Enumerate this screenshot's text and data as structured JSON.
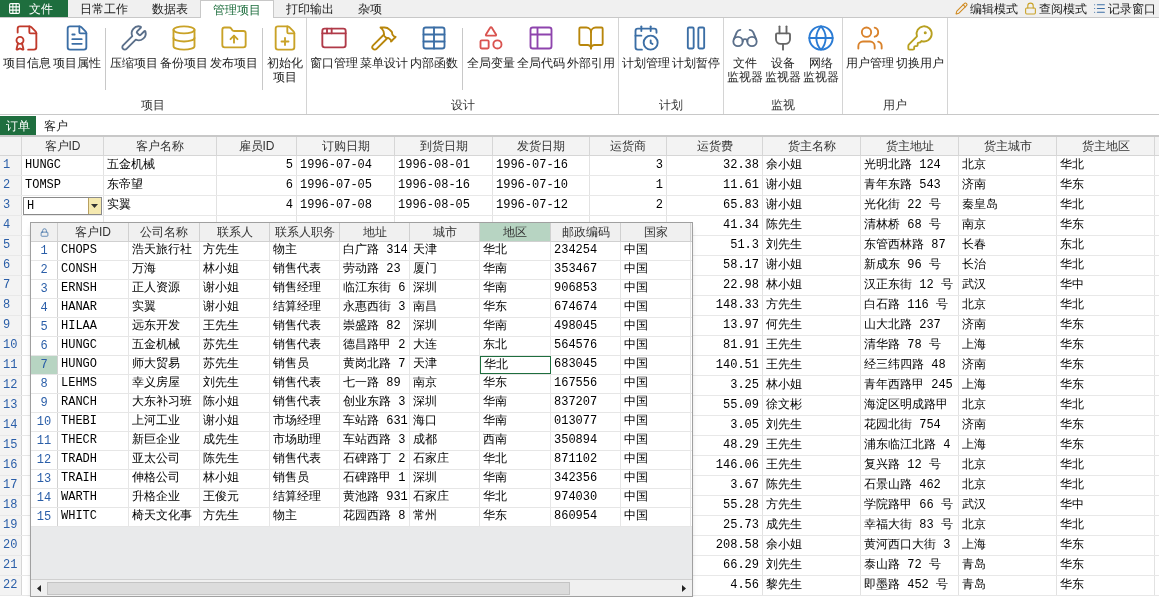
{
  "file_menu": {
    "label": "文件"
  },
  "menu_tabs": [
    {
      "label": "日常工作",
      "selected": false
    },
    {
      "label": "数据表",
      "selected": false
    },
    {
      "label": "管理项目",
      "selected": true
    },
    {
      "label": "打印输出",
      "selected": false
    },
    {
      "label": "杂项",
      "selected": false
    }
  ],
  "mode_buttons": [
    {
      "label": "编辑模式"
    },
    {
      "label": "查阅模式"
    },
    {
      "label": "记录窗口"
    }
  ],
  "ribbon_groups": [
    {
      "title": "项目",
      "buttons": [
        {
          "lines": [
            "项目信息"
          ],
          "separator_before": false
        },
        {
          "lines": [
            "项目属性"
          ],
          "separator_before": false
        },
        {
          "lines": [
            "压缩项目"
          ],
          "separator_before": true
        },
        {
          "lines": [
            "备份项目"
          ],
          "separator_before": false
        },
        {
          "lines": [
            "发布项目"
          ],
          "separator_before": false
        },
        {
          "lines": [
            "初始化",
            "项目"
          ],
          "separator_before": true
        }
      ]
    },
    {
      "title": "设计",
      "buttons": [
        {
          "lines": [
            "窗口管理"
          ],
          "separator_before": false
        },
        {
          "lines": [
            "菜单设计"
          ],
          "separator_before": false
        },
        {
          "lines": [
            "内部函数"
          ],
          "separator_before": false
        },
        {
          "lines": [
            "全局变量"
          ],
          "separator_before": true
        },
        {
          "lines": [
            "全局代码"
          ],
          "separator_before": false
        },
        {
          "lines": [
            "外部引用"
          ],
          "separator_before": false
        }
      ]
    },
    {
      "title": "计划",
      "buttons": [
        {
          "lines": [
            "计划管理"
          ],
          "separator_before": false
        },
        {
          "lines": [
            "计划暂停"
          ],
          "separator_before": false
        }
      ]
    },
    {
      "title": "监视",
      "buttons": [
        {
          "lines": [
            "文件",
            "监视器"
          ],
          "separator_before": false
        },
        {
          "lines": [
            "设备",
            "监视器"
          ],
          "separator_before": false
        },
        {
          "lines": [
            "网络",
            "监视器"
          ],
          "separator_before": false
        }
      ]
    },
    {
      "title": "用户",
      "buttons": [
        {
          "lines": [
            "用户管理"
          ],
          "separator_before": false
        },
        {
          "lines": [
            "切换用户"
          ],
          "separator_before": false
        }
      ]
    }
  ],
  "doc_tabs": [
    {
      "label": "订单",
      "selected": true
    },
    {
      "label": "客户",
      "selected": false
    }
  ],
  "orders_grid": {
    "columns": [
      "客户ID",
      "客户名称",
      "雇员ID",
      "订购日期",
      "到货日期",
      "发货日期",
      "运货商",
      "运货费",
      "货主名称",
      "货主地址",
      "货主城市",
      "货主地区"
    ],
    "rows": [
      {
        "number": "1",
        "cells": [
          "HUNGC",
          "五金机械",
          "5",
          "1996-07-04",
          "1996-08-01",
          "1996-07-16",
          "3",
          "32.38",
          "余小姐",
          "光明北路 124",
          "北京",
          "华北"
        ]
      },
      {
        "number": "2",
        "cells": [
          "TOMSP",
          "东帝望",
          "6",
          "1996-07-05",
          "1996-08-16",
          "1996-07-10",
          "1",
          "11.61",
          "谢小姐",
          "青年东路 543",
          "济南",
          "华东"
        ]
      },
      {
        "number": "3",
        "editing": true,
        "cells": [
          "H",
          "实翼",
          "4",
          "1996-07-08",
          "1996-08-05",
          "1996-07-12",
          "2",
          "65.83",
          "谢小姐",
          "光化街 22 号",
          "秦皇岛",
          "华北"
        ]
      },
      {
        "number": "4",
        "cells": [
          "41.34",
          "陈先生",
          "清林桥 68 号",
          "南京",
          "华东"
        ]
      },
      {
        "number": "5",
        "cells": [
          "51.3",
          "刘先生",
          "东管西林路 87",
          "长春",
          "东北"
        ]
      },
      {
        "number": "6",
        "cells": [
          "58.17",
          "谢小姐",
          "新成东 96 号",
          "长治",
          "华北"
        ]
      },
      {
        "number": "7",
        "cells": [
          "22.98",
          "林小姐",
          "汉正东街 12 号",
          "武汉",
          "华中"
        ]
      },
      {
        "number": "8",
        "cells": [
          "148.33",
          "方先生",
          "白石路 116 号",
          "北京",
          "华北"
        ]
      },
      {
        "number": "9",
        "cells": [
          "13.97",
          "何先生",
          "山大北路 237",
          "济南",
          "华东"
        ]
      },
      {
        "number": "10",
        "cells": [
          "81.91",
          "王先生",
          "清华路 78 号",
          "上海",
          "华东"
        ]
      },
      {
        "number": "11",
        "cells": [
          "140.51",
          "王先生",
          "经三纬四路 48",
          "济南",
          "华东"
        ]
      },
      {
        "number": "12",
        "cells": [
          "3.25",
          "林小姐",
          "青年西路甲 245",
          "上海",
          "华东"
        ]
      },
      {
        "number": "13",
        "cells": [
          "55.09",
          "徐文彬",
          "海淀区明成路甲",
          "北京",
          "华北"
        ]
      },
      {
        "number": "14",
        "cells": [
          "3.05",
          "刘先生",
          "花园北街 754",
          "济南",
          "华东"
        ]
      },
      {
        "number": "15",
        "cells": [
          "48.29",
          "王先生",
          "浦东临江北路 4",
          "上海",
          "华东"
        ]
      },
      {
        "number": "16",
        "cells": [
          "146.06",
          "王先生",
          "复兴路 12 号",
          "北京",
          "华北"
        ]
      },
      {
        "number": "17",
        "cells": [
          "3.67",
          "陈先生",
          "石景山路 462",
          "北京",
          "华北"
        ]
      },
      {
        "number": "18",
        "cells": [
          "55.28",
          "方先生",
          "学院路甲 66 号",
          "武汉",
          "华中"
        ]
      },
      {
        "number": "19",
        "cells": [
          "25.73",
          "成先生",
          "幸福大街 83 号",
          "北京",
          "华北"
        ]
      },
      {
        "number": "20",
        "cells": [
          "208.58",
          "余小姐",
          "黄河西口大街 3",
          "上海",
          "华东"
        ]
      },
      {
        "number": "21",
        "cells": [
          "66.29",
          "刘先生",
          "泰山路 72 号",
          "青岛",
          "华东"
        ]
      },
      {
        "number": "22",
        "cells": [
          "4.56",
          "黎先生",
          "即墨路 452 号",
          "青岛",
          "华东"
        ]
      }
    ]
  },
  "lookup_popup": {
    "columns": [
      {
        "label": "客户ID",
        "selected": false
      },
      {
        "label": "公司名称",
        "selected": false
      },
      {
        "label": "联系人",
        "selected": false
      },
      {
        "label": "联系人职务",
        "selected": false
      },
      {
        "label": "地址",
        "selected": false
      },
      {
        "label": "城市",
        "selected": false
      },
      {
        "label": "地区",
        "selected": true
      },
      {
        "label": "邮政编码",
        "selected": false
      },
      {
        "label": "国家",
        "selected": false
      }
    ],
    "rows": [
      {
        "number": "1",
        "selected": false,
        "cells": [
          "CHOPS",
          "浩天旅行社",
          "方先生",
          "物主",
          "白广路 314",
          "天津",
          "华北",
          "234254",
          "中国"
        ]
      },
      {
        "number": "2",
        "selected": false,
        "cells": [
          "CONSH",
          "万海",
          "林小姐",
          "销售代表",
          "劳动路 23",
          "厦门",
          "华南",
          "353467",
          "中国"
        ]
      },
      {
        "number": "3",
        "selected": false,
        "cells": [
          "ERNSH",
          "正人资源",
          "谢小姐",
          "销售经理",
          "临江东街 6",
          "深圳",
          "华南",
          "906853",
          "中国"
        ]
      },
      {
        "number": "4",
        "selected": false,
        "cells": [
          "HANAR",
          "实翼",
          "谢小姐",
          "结算经理",
          "永惠西街 3",
          "南昌",
          "华东",
          "674674",
          "中国"
        ]
      },
      {
        "number": "5",
        "selected": false,
        "cells": [
          "HILAA",
          "远东开发",
          "王先生",
          "销售代表",
          "崇盛路 82",
          "深圳",
          "华南",
          "498045",
          "中国"
        ]
      },
      {
        "number": "6",
        "selected": false,
        "cells": [
          "HUNGC",
          "五金机械",
          "苏先生",
          "销售代表",
          "德昌路甲 2",
          "大连",
          "东北",
          "564576",
          "中国"
        ]
      },
      {
        "number": "7",
        "selected": true,
        "cells": [
          "HUNGO",
          "师大贸易",
          "苏先生",
          "销售员",
          "黄岗北路 7",
          "天津",
          "华北",
          "683045",
          "中国"
        ]
      },
      {
        "number": "8",
        "selected": false,
        "cells": [
          "LEHMS",
          "幸义房屋",
          "刘先生",
          "销售代表",
          "七一路 89",
          "南京",
          "华东",
          "167556",
          "中国"
        ]
      },
      {
        "number": "9",
        "selected": false,
        "cells": [
          "RANCH",
          "大东补习班",
          "陈小姐",
          "销售代表",
          "创业东路 3",
          "深圳",
          "华南",
          "837207",
          "中国"
        ]
      },
      {
        "number": "10",
        "selected": false,
        "cells": [
          "THEBI",
          "上河工业",
          "谢小姐",
          "市场经理",
          "车站路 631",
          "海口",
          "华南",
          "013077",
          "中国"
        ]
      },
      {
        "number": "11",
        "selected": false,
        "cells": [
          "THECR",
          "新巨企业",
          "成先生",
          "市场助理",
          "车站西路 3",
          "成都",
          "西南",
          "350894",
          "中国"
        ]
      },
      {
        "number": "12",
        "selected": false,
        "cells": [
          "TRADH",
          "亚太公司",
          "陈先生",
          "销售代表",
          "石碑路丁 2",
          "石家庄",
          "华北",
          "871102",
          "中国"
        ]
      },
      {
        "number": "13",
        "selected": false,
        "cells": [
          "TRAIH",
          "伸格公司",
          "林小姐",
          "销售员",
          "石碑路甲 1",
          "深圳",
          "华南",
          "342356",
          "中国"
        ]
      },
      {
        "number": "14",
        "selected": false,
        "cells": [
          "WARTH",
          "升格企业",
          "王俊元",
          "结算经理",
          "黄池路 931",
          "石家庄",
          "华北",
          "974030",
          "中国"
        ]
      },
      {
        "number": "15",
        "selected": false,
        "cells": [
          "WHITC",
          "椅天文化事",
          "方先生",
          "物主",
          "花园西路 8",
          "常州",
          "华东",
          "860954",
          "中国"
        ]
      }
    ]
  }
}
